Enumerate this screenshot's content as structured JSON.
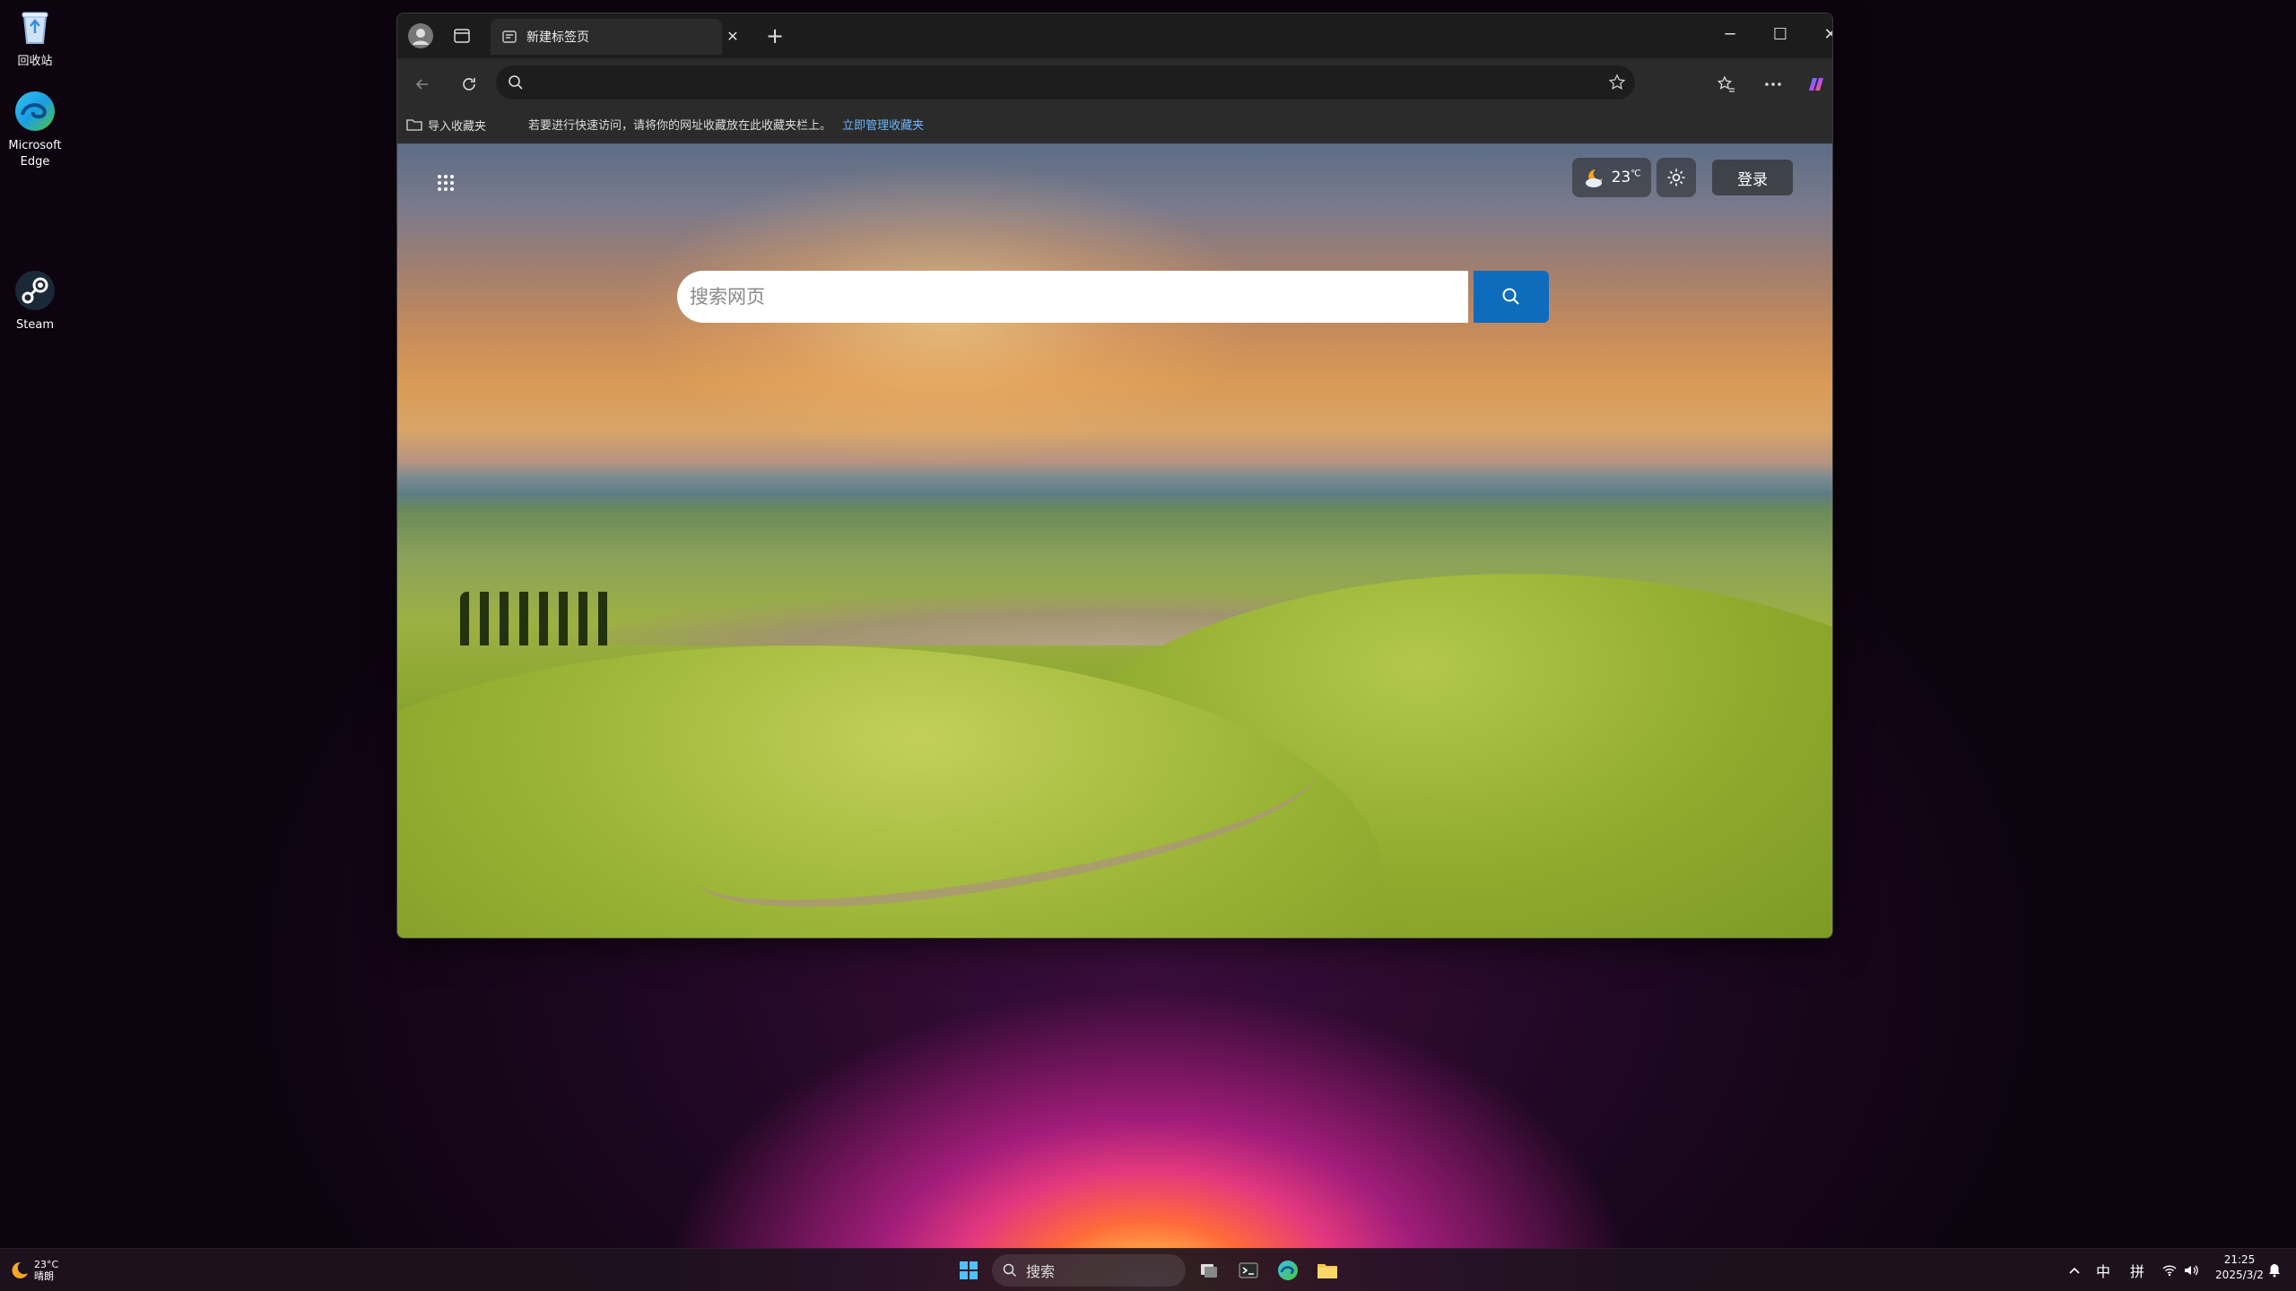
{
  "desktop": {
    "icons": [
      {
        "label": "回收站"
      },
      {
        "label": "Microsoft Edge"
      },
      {
        "label": "Steam"
      }
    ]
  },
  "browser": {
    "tab": {
      "title": "新建标签页",
      "close": "✕",
      "new": "+"
    },
    "window": {
      "minimize": "─",
      "maximize": "☐",
      "close": "✕"
    },
    "address": {
      "value": "",
      "placeholder": ""
    },
    "favbar": {
      "import_label": "导入收藏夹",
      "message": "若要进行快速访问，请将你的网址收藏放在此收藏夹栏上。",
      "manage_link": "立即管理收藏夹"
    },
    "newtab": {
      "weather_temp": "23",
      "weather_unit": "℃",
      "login_label": "登录",
      "search_placeholder": "搜索网页"
    }
  },
  "taskbar": {
    "weather_temp": "23°C",
    "weather_desc": "晴朗",
    "search_label": "搜索",
    "ime_lang": "中",
    "ime_mode": "拼",
    "time": "21:25",
    "date": "2025/3/2"
  },
  "colors": {
    "accent": "#0f6cbd",
    "link": "#6cb6ff",
    "browser_bg": "#202020"
  }
}
